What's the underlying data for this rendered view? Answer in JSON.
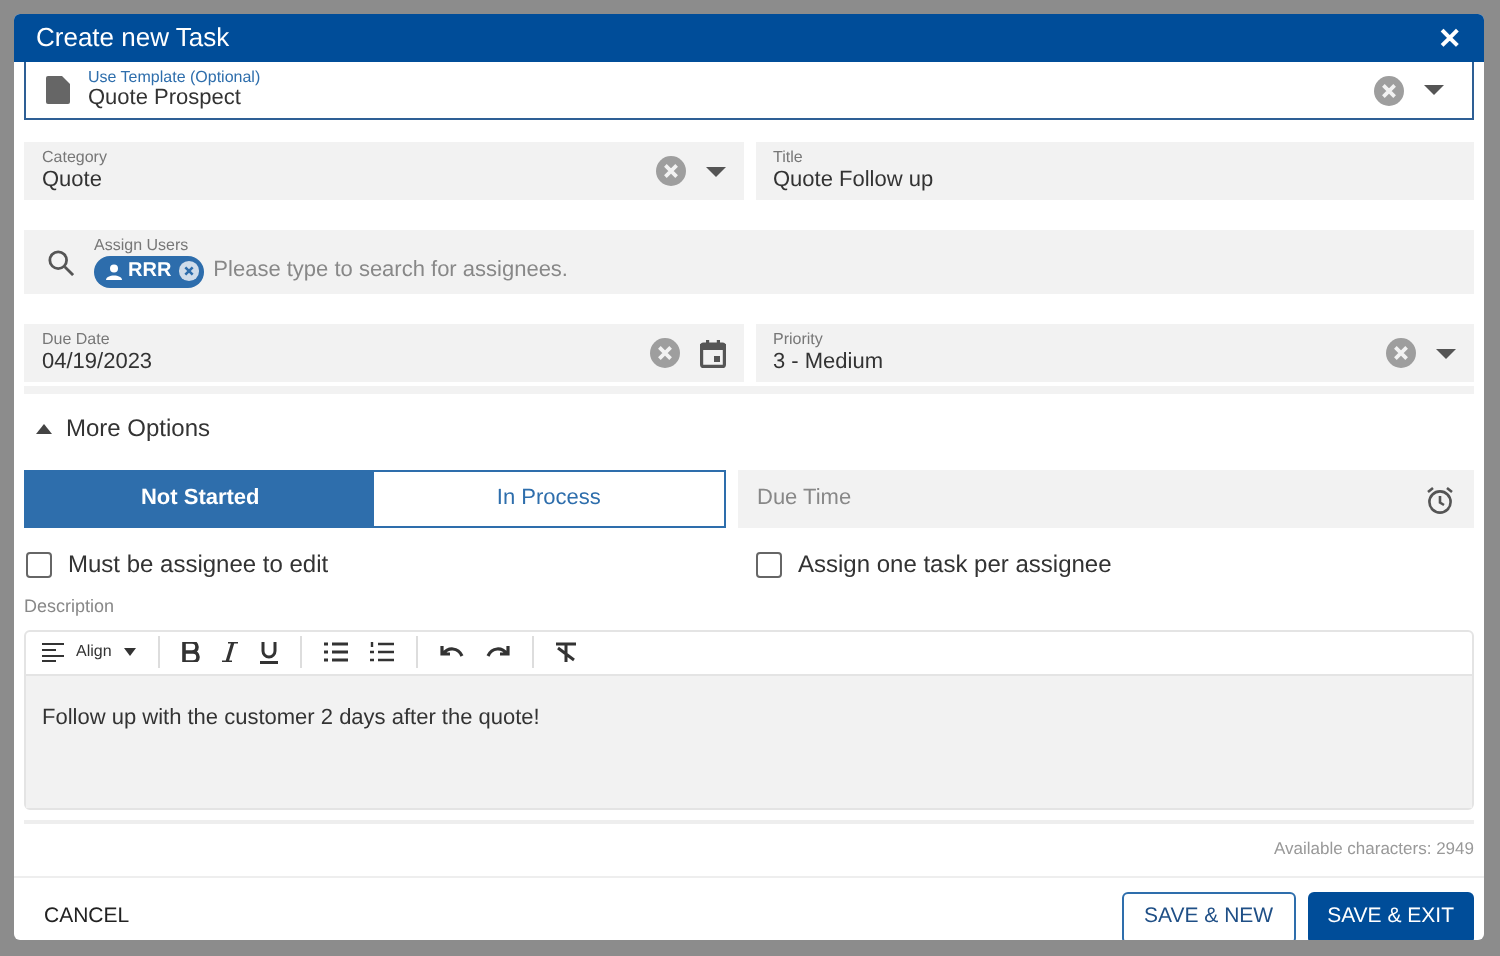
{
  "dialog": {
    "title": "Create new Task",
    "close": "✕"
  },
  "template": {
    "label": "Use Template (Optional)",
    "value": "Quote Prospect"
  },
  "category": {
    "label": "Category",
    "value": "Quote"
  },
  "title_field": {
    "label": "Title",
    "value": "Quote Follow up"
  },
  "assign": {
    "label": "Assign Users",
    "chips": [
      {
        "text": "RRR"
      }
    ],
    "placeholder": "Please type to search for assignees."
  },
  "due_date": {
    "label": "Due Date",
    "value": "04/19/2023"
  },
  "priority": {
    "label": "Priority",
    "value": "3 - Medium"
  },
  "more_options": {
    "label": "More Options",
    "expanded": true
  },
  "status": [
    {
      "label": "Not Started",
      "selected": true
    },
    {
      "label": "In Process",
      "selected": false
    }
  ],
  "due_time": {
    "placeholder": "Due Time"
  },
  "checkboxes": [
    {
      "label": "Must be assignee to edit",
      "checked": false
    },
    {
      "label": "Assign one task per assignee",
      "checked": false
    }
  ],
  "description": {
    "label": "Description",
    "align": "Align",
    "text": "Follow up with the customer 2 days after the quote!",
    "available": "Available characters: 2949"
  },
  "buttons": [
    {
      "label": "CANCEL",
      "kind": "text"
    },
    {
      "label": "SAVE & NEW",
      "kind": "outline"
    },
    {
      "label": "SAVE & EXIT",
      "kind": "primary"
    }
  ]
}
